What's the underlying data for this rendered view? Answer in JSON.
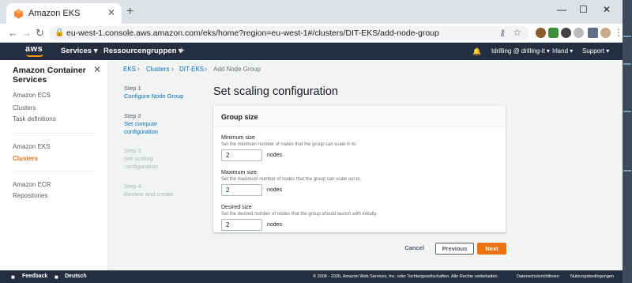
{
  "browser": {
    "tab_title": "Amazon EKS",
    "tab_close": "✕",
    "new_tab": "+",
    "controls": {
      "minimize": "—",
      "maximize": "☐",
      "close": "✕"
    },
    "nav": {
      "back": "←",
      "forward": "→",
      "reload": "↻"
    },
    "url": "eu-west-1.console.aws.amazon.com/eks/home?region=eu-west-1#/clusters/DIT-EKS/add-node-group",
    "lock": "🔒",
    "key": "⚷",
    "star": "☆",
    "menu": "⋮"
  },
  "awsnav": {
    "logo": "aws",
    "services": "Services ▾",
    "resource_groups": "Ressourcengruppen ▾",
    "pin": "✦",
    "bell": "🔔",
    "account": "tdrilling @ drilling-it ▾",
    "region": "Irland ▾",
    "support": "Support ▾"
  },
  "sidebar": {
    "title": "Amazon Container Services",
    "close": "✕",
    "items": [
      {
        "label": "Amazon ECS"
      },
      {
        "label": "Clusters"
      },
      {
        "label": "Task definitions"
      },
      {
        "label": "Amazon EKS"
      },
      {
        "label": "Clusters"
      },
      {
        "label": "Amazon ECR"
      },
      {
        "label": "Repositories"
      }
    ]
  },
  "breadcrumb": {
    "items": [
      "EKS",
      "Clusters",
      "DIT-EKS",
      "Add Node Group"
    ],
    "sep": "›"
  },
  "steps": [
    {
      "num": "Step 1",
      "label": "Configure Node Group"
    },
    {
      "num": "Step 2",
      "label": "Set compute configuration"
    },
    {
      "num": "Step 3",
      "label": "Set scaling configuration"
    },
    {
      "num": "Step 4",
      "label": "Review and create"
    }
  ],
  "page_title": "Set scaling configuration",
  "group": {
    "header": "Group size",
    "fields": [
      {
        "label": "Minimum size",
        "desc": "Set the minimum number of nodes that the group can scale in to.",
        "value": "2",
        "unit": "nodes"
      },
      {
        "label": "Maximum size",
        "desc": "Set the maximum number of nodes that the group can scale out to.",
        "value": "2",
        "unit": "nodes"
      },
      {
        "label": "Desired size",
        "desc": "Set the desired number of nodes that the group should launch with initially.",
        "value": "2",
        "unit": "nodes"
      }
    ]
  },
  "buttons": {
    "cancel": "Cancel",
    "previous": "Previous",
    "next": "Next"
  },
  "footer": {
    "feedback": "Feedback",
    "language": "Deutsch",
    "copyright": "© 2008 - 2020, Amazon Web Services, Inc. oder Tochtergesellschaften. Alle Rechte vorbehalten.",
    "privacy": "Datenschutzrichtlinien",
    "terms": "Nutzungsbedingungen"
  },
  "colors": {
    "aws_nav": "#232f3e",
    "accent": "#ec7211",
    "link": "#0073bb"
  }
}
